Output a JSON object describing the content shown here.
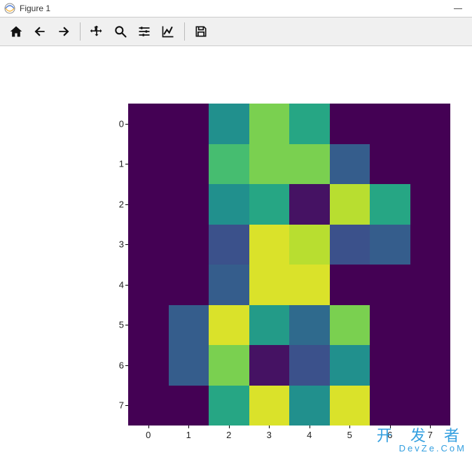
{
  "window": {
    "title": "Figure 1"
  },
  "toolbar": {
    "home": "Home",
    "back": "Back",
    "forward": "Forward",
    "pan": "Pan",
    "zoom": "Zoom",
    "subplots": "Configure subplots",
    "edit": "Edit axis",
    "save": "Save"
  },
  "watermark": {
    "line1": "开 发 者",
    "line2": "DevZe.CoM"
  },
  "chart_data": {
    "type": "heatmap",
    "title": "",
    "xlabel": "",
    "ylabel": "",
    "x_ticks": [
      0,
      1,
      2,
      3,
      4,
      5,
      6,
      7
    ],
    "y_ticks": [
      0,
      1,
      2,
      3,
      4,
      5,
      6,
      7
    ],
    "xlim": [
      -0.5,
      7.5
    ],
    "ylim": [
      7.5,
      -0.5
    ],
    "colormap": "viridis",
    "value_range_estimate": [
      0,
      1
    ],
    "z": [
      [
        0.0,
        0.0,
        0.5,
        0.8,
        0.6,
        0.0,
        0.0,
        0.0
      ],
      [
        0.0,
        0.0,
        0.7,
        0.8,
        0.8,
        0.3,
        0.0,
        0.0
      ],
      [
        0.0,
        0.0,
        0.5,
        0.6,
        0.05,
        0.9,
        0.6,
        0.0
      ],
      [
        0.0,
        0.0,
        0.25,
        0.95,
        0.9,
        0.25,
        0.3,
        0.0
      ],
      [
        0.0,
        0.0,
        0.3,
        0.95,
        0.95,
        0.0,
        0.0,
        0.0
      ],
      [
        0.0,
        0.3,
        0.95,
        0.55,
        0.35,
        0.8,
        0.0,
        0.0
      ],
      [
        0.0,
        0.3,
        0.8,
        0.05,
        0.25,
        0.5,
        0.0,
        0.0
      ],
      [
        0.0,
        0.0,
        0.6,
        0.95,
        0.5,
        0.95,
        0.0,
        0.0
      ]
    ],
    "note": "z values are estimated (0..1) from viridis colors; 0.00 = dark purple background, ~0.3 = blue, ~0.5 = teal, ~0.7-0.8 = green, ~0.95 = yellow"
  }
}
